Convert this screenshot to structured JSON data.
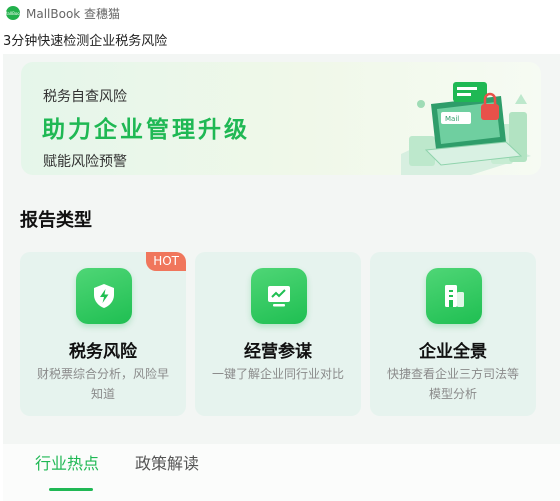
{
  "window": {
    "app_name": "MallBook 查穗猫",
    "logo_text": "MallBook"
  },
  "page": {
    "heading": "3分钟快速检测企业税务风险"
  },
  "banner": {
    "subtitle": "税务自查风险",
    "title": "助力企业管理升级",
    "description": "赋能风险预警",
    "art_label": "Mail"
  },
  "section": {
    "title": "报告类型"
  },
  "cards": [
    {
      "title": "税务风险",
      "description": "财税票综合分析，风险早知道",
      "badge": "HOT",
      "icon": "shield-lightning-icon"
    },
    {
      "title": "经营参谋",
      "description": "一键了解企业同行业对比",
      "icon": "chart-monitor-icon"
    },
    {
      "title": "企业全景",
      "description": "快捷查看企业三方司法等模型分析",
      "icon": "building-icon"
    }
  ],
  "tabs": [
    {
      "label": "行业热点",
      "active": true
    },
    {
      "label": "政策解读",
      "active": false
    }
  ],
  "colors": {
    "accent": "#1fb854",
    "hot_badge": "#f0765c",
    "card_bg": "#e6f3ee"
  }
}
